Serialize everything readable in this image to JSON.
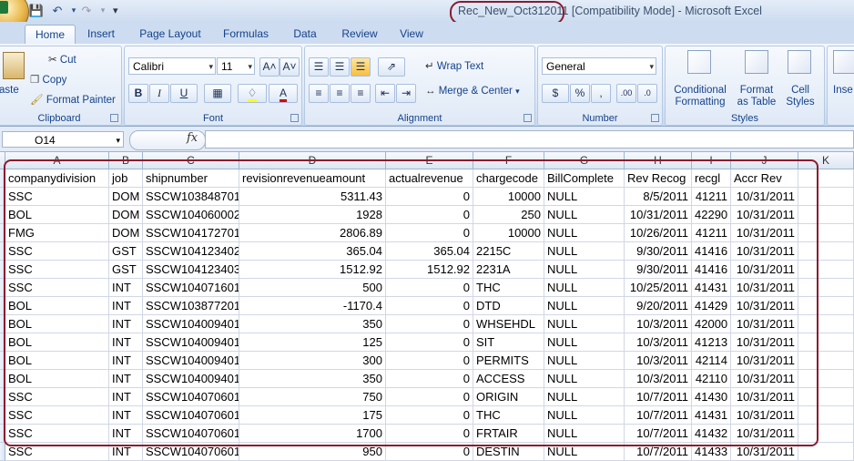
{
  "window": {
    "title_file": "Rec_New_Oct312011",
    "title_rest": " [Compatibility Mode] - Microsoft Excel",
    "qat_more": "▾"
  },
  "tabs": [
    "Home",
    "Insert",
    "Page Layout",
    "Formulas",
    "Data",
    "Review",
    "View"
  ],
  "clipboard": {
    "paste": "aste",
    "cut": "Cut",
    "copy": "Copy",
    "format_painter": "Format Painter",
    "label": "Clipboard"
  },
  "font": {
    "name": "Calibri",
    "size": "11",
    "label": "Font",
    "bold": "B",
    "italic": "I",
    "underline": "U",
    "grow": "A˄",
    "shrink": "A˅"
  },
  "alignment": {
    "wrap_text": "Wrap Text",
    "merge_center": "Merge & Center",
    "label": "Alignment"
  },
  "number": {
    "format": "General",
    "currency": "$",
    "percent": "%",
    "comma": ",",
    "inc_dec": ".00",
    "dec_dec": ".0",
    "label": "Number"
  },
  "styles": {
    "conditional": "Conditional",
    "conditional2": "Formatting",
    "format_as": "Format",
    "format_as2": "as Table",
    "cell": "Cell",
    "cell2": "Styles",
    "label": "Styles"
  },
  "cells": {
    "insert": "Inse"
  },
  "formula_bar": {
    "name_box": "O14",
    "fx": "fx",
    "value": ""
  },
  "columns": [
    {
      "letter": "A",
      "w": 114
    },
    {
      "letter": "B",
      "w": 37
    },
    {
      "letter": "C",
      "w": 106
    },
    {
      "letter": "D",
      "w": 161
    },
    {
      "letter": "E",
      "w": 96
    },
    {
      "letter": "F",
      "w": 78
    },
    {
      "letter": "G",
      "w": 88
    },
    {
      "letter": "H",
      "w": 74
    },
    {
      "letter": "I",
      "w": 43
    },
    {
      "letter": "J",
      "w": 74
    },
    {
      "letter": "K",
      "w": 61
    }
  ],
  "headers": [
    "companydivision",
    "job",
    "shipnumber",
    "revisionrevenueamount",
    "actualrevenue",
    "chargecode",
    "BillComplete",
    "Rev Recog",
    "recgl",
    "Accr Rev"
  ],
  "rows": [
    [
      "SSC",
      "DOM",
      "SSCW103848701",
      "5311.43",
      "0",
      "10000",
      "NULL",
      "8/5/2011",
      "41211",
      "10/31/2011"
    ],
    [
      "BOL",
      "DOM",
      "SSCW104060002",
      "1928",
      "0",
      "250",
      "NULL",
      "10/31/2011",
      "42290",
      "10/31/2011"
    ],
    [
      "FMG",
      "DOM",
      "SSCW104172701",
      "2806.89",
      "0",
      "10000",
      "NULL",
      "10/26/2011",
      "41211",
      "10/31/2011"
    ],
    [
      "SSC",
      "GST",
      "SSCW104123402",
      "365.04",
      "365.04",
      "2215C",
      "NULL",
      "9/30/2011",
      "41416",
      "10/31/2011"
    ],
    [
      "SSC",
      "GST",
      "SSCW104123403",
      "1512.92",
      "1512.92",
      "2231A",
      "NULL",
      "9/30/2011",
      "41416",
      "10/31/2011"
    ],
    [
      "SSC",
      "INT",
      "SSCW104071601",
      "500",
      "0",
      "THC",
      "NULL",
      "10/25/2011",
      "41431",
      "10/31/2011"
    ],
    [
      "BOL",
      "INT",
      "SSCW103877201",
      "-1170.4",
      "0",
      "DTD",
      "NULL",
      "9/20/2011",
      "41429",
      "10/31/2011"
    ],
    [
      "BOL",
      "INT",
      "SSCW104009401",
      "350",
      "0",
      "WHSEHDL",
      "NULL",
      "10/3/2011",
      "42000",
      "10/31/2011"
    ],
    [
      "BOL",
      "INT",
      "SSCW104009401",
      "125",
      "0",
      "SIT",
      "NULL",
      "10/3/2011",
      "41213",
      "10/31/2011"
    ],
    [
      "BOL",
      "INT",
      "SSCW104009401",
      "300",
      "0",
      "PERMITS",
      "NULL",
      "10/3/2011",
      "42114",
      "10/31/2011"
    ],
    [
      "BOL",
      "INT",
      "SSCW104009401",
      "350",
      "0",
      "ACCESS",
      "NULL",
      "10/3/2011",
      "42110",
      "10/31/2011"
    ],
    [
      "SSC",
      "INT",
      "SSCW104070601",
      "750",
      "0",
      "ORIGIN",
      "NULL",
      "10/7/2011",
      "41430",
      "10/31/2011"
    ],
    [
      "SSC",
      "INT",
      "SSCW104070601",
      "175",
      "0",
      "THC",
      "NULL",
      "10/7/2011",
      "41431",
      "10/31/2011"
    ],
    [
      "SSC",
      "INT",
      "SSCW104070601",
      "1700",
      "0",
      "FRTAIR",
      "NULL",
      "10/7/2011",
      "41432",
      "10/31/2011"
    ],
    [
      "SSC",
      "INT",
      "SSCW104070601",
      "950",
      "0",
      "DESTIN",
      "NULL",
      "10/7/2011",
      "41433",
      "10/31/2011"
    ]
  ],
  "numeric_columns": [
    3,
    4,
    7,
    8,
    9
  ],
  "numeric_text_columns": [
    5
  ],
  "colors": {
    "annotation": "#8b1b2e",
    "ribbon_text": "#15428b"
  }
}
